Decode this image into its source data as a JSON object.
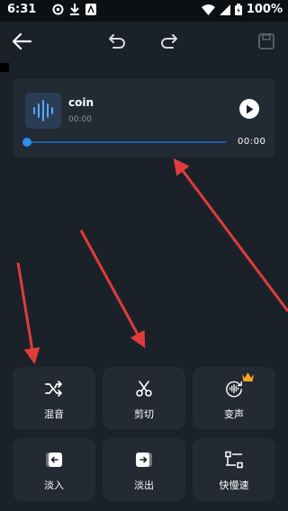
{
  "status_bar": {
    "time": "6:31",
    "battery": "100%"
  },
  "toolbar": {
    "back_icon": "arrow-left-icon",
    "undo_icon": "undo-icon",
    "redo_icon": "redo-icon",
    "save_icon": "save-icon"
  },
  "track": {
    "title": "coin",
    "current_time": "00:00",
    "duration": "00:00",
    "progress": 0
  },
  "tools": [
    {
      "label": "混音",
      "icon": "shuffle-icon"
    },
    {
      "label": "剪切",
      "icon": "scissors-icon"
    },
    {
      "label": "变声",
      "icon": "voice-change-icon",
      "badge": "crown-icon"
    },
    {
      "label": "淡入",
      "icon": "fade-in-icon"
    },
    {
      "label": "淡出",
      "icon": "fade-out-icon"
    },
    {
      "label": "快慢速",
      "icon": "speed-icon"
    }
  ],
  "colors": {
    "background": "#1b2129",
    "card": "#222a33",
    "accent": "#2f8ef0",
    "annotation_arrow": "#e03c3c",
    "crown": "#f5a623"
  }
}
